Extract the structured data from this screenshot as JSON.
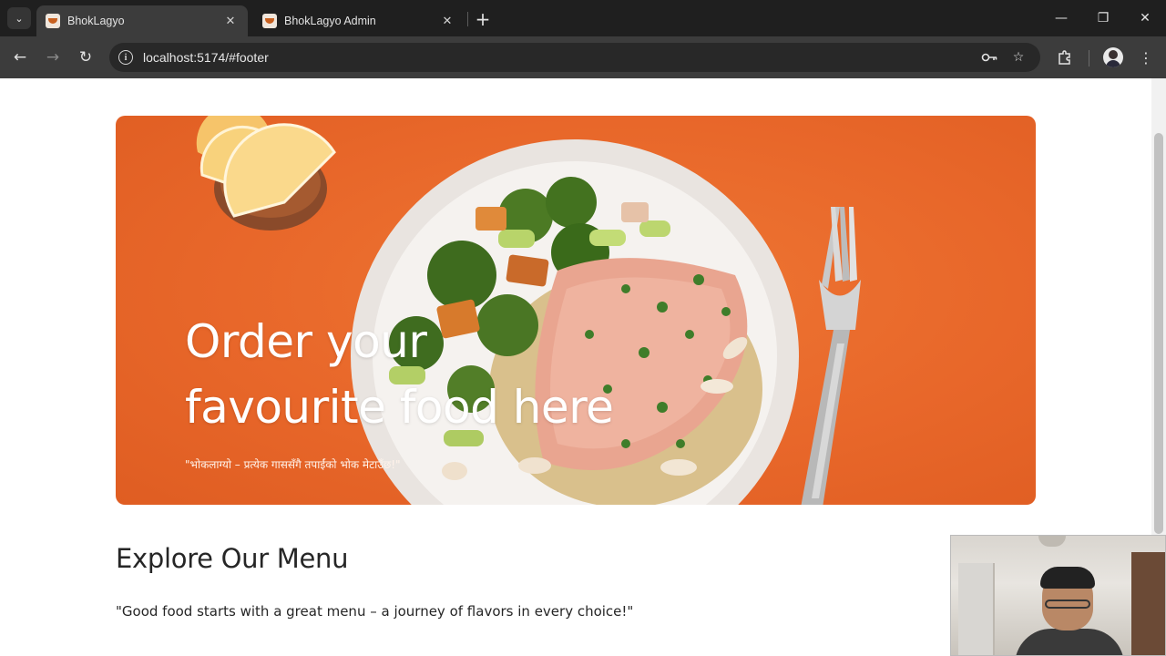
{
  "browser": {
    "tabs": [
      {
        "title": "BhokLagyo",
        "active": true
      },
      {
        "title": "BhokLagyo Admin",
        "active": false
      }
    ],
    "url": "localhost:5174/#footer",
    "icons": {
      "tab_search": "chevron-down-icon",
      "close": "close-icon",
      "new_tab": "plus-icon",
      "back": "arrow-left-icon",
      "forward": "arrow-right-icon",
      "reload": "reload-icon",
      "site_info": "info-icon",
      "password": "key-icon",
      "bookmark": "star-icon",
      "extensions": "puzzle-icon",
      "menu": "kebab-icon"
    }
  },
  "hero": {
    "title_line1": "Order your",
    "title_line2": "favourite food here",
    "subtitle": "\"भोकलाग्यो – प्रत्येक गाससँगै तपाईंको भोक मेटाउँछ!\""
  },
  "menu": {
    "heading": "Explore Our Menu",
    "tagline": "\"Good food starts with a great menu – a journey of flavors in every choice!\""
  },
  "colors": {
    "hero_orange": "#e8672a",
    "chrome_dark": "#1f1f1f",
    "toolbar": "#3c3c3c",
    "text_dark": "#262626"
  }
}
